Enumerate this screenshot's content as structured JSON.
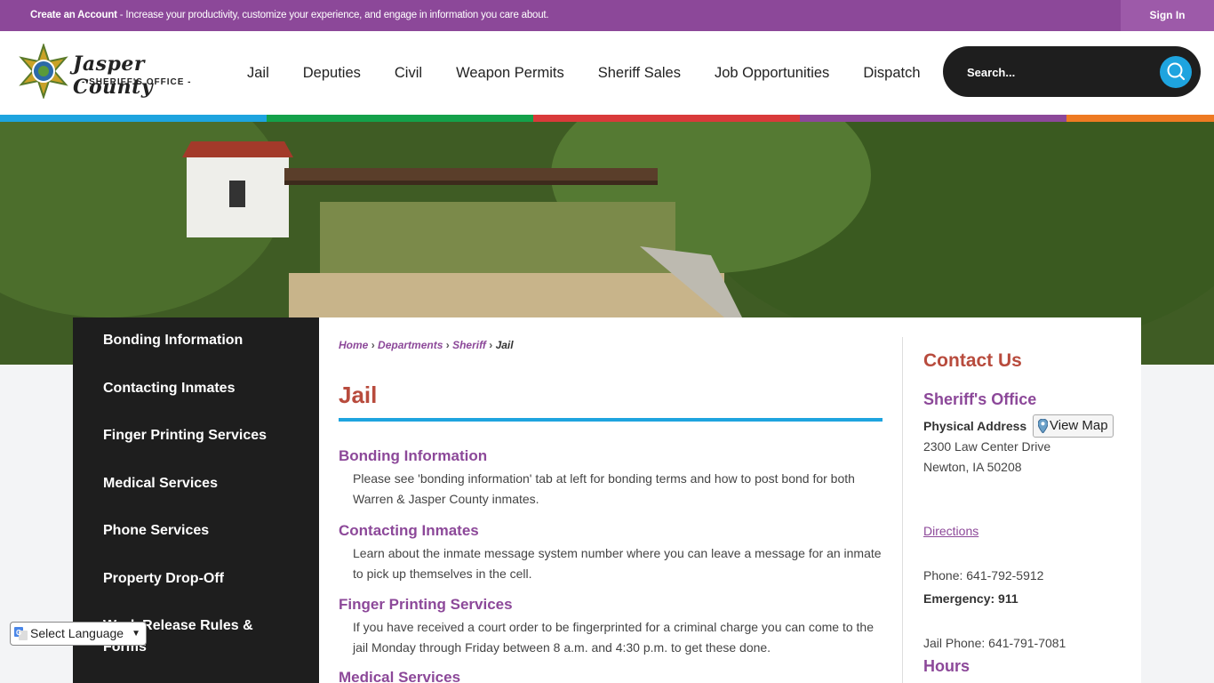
{
  "topbar": {
    "promo_bold": "Create an Account",
    "promo_text": " - Increase your productivity, customize your experience, and engage in information you care about.",
    "signin": "Sign In"
  },
  "logo": {
    "title": "Jasper County",
    "subtitle": "- SHERIFF'S OFFICE -"
  },
  "nav": [
    "Jail",
    "Deputies",
    "Civil",
    "Weapon Permits",
    "Sheriff Sales",
    "Job Opportunities",
    "Dispatch"
  ],
  "search": {
    "placeholder": "Search..."
  },
  "stripe_colors": [
    "#1ea4df",
    "#14a14a",
    "#d93a3a",
    "#8c4899",
    "#ee7a22"
  ],
  "sidebar": [
    "Bonding Information",
    "Contacting Inmates",
    "Finger Printing Services",
    "Medical Services",
    "Phone Services",
    "Property Drop-Off",
    "Work Release Rules & Forms"
  ],
  "breadcrumb": {
    "home": "Home",
    "departments": "Departments",
    "sheriff": "Sheriff",
    "current": "Jail",
    "sep": "›"
  },
  "page_title": "Jail",
  "sections": [
    {
      "title": "Bonding Information",
      "text": "Please see 'bonding information' tab at left for bonding terms and how to post bond for both Warren & Jasper County inmates."
    },
    {
      "title": "Contacting Inmates",
      "text": "Learn about the inmate message system number where you can leave a message for an inmate to pick up themselves in the cell."
    },
    {
      "title": "Finger Printing Services",
      "text": "If you have received a court order to be fingerprinted for a criminal charge you can come to the jail Monday through Friday between 8 a.m. and 4:30 p.m. to get these done."
    },
    {
      "title": "Medical Services",
      "text": ""
    }
  ],
  "contact": {
    "heading": "Contact Us",
    "office": "Sheriff's Office",
    "address_label": "Physical Address",
    "view_map": "View Map",
    "street": "2300 Law Center Drive",
    "city": "Newton, IA 50208",
    "directions": "Directions",
    "phone": "Phone: 641-792-5912",
    "emergency": "Emergency: 911",
    "jail_phone": "Jail Phone: 641-791-7081",
    "hours": "Hours"
  },
  "translate": {
    "label": "Select Language"
  }
}
